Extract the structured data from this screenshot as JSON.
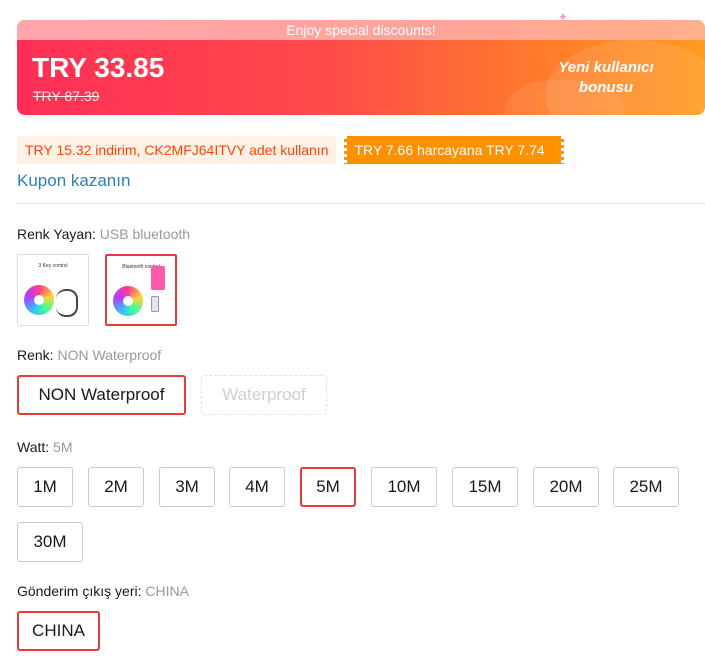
{
  "banner": {
    "strip_text": "Enjoy special discounts!",
    "price": "TRY 33.85",
    "original_price": "TRY 87.39",
    "bonus_label": "Yeni kullanıcı bonusu"
  },
  "coupons": {
    "discount_text": "TRY 15.32 indirim, CK2MFJ64ITVY adet kullanın",
    "threshold_text": "TRY 7.66 harcayana TRY 7.74"
  },
  "kupon_link": "Kupon kazanın",
  "renk_yayan": {
    "label": "Renk Yayan:",
    "value": "USB bluetooth",
    "thumbs": [
      {
        "caption": "3 Key control",
        "selected": false
      },
      {
        "caption": "Bluetooth control",
        "selected": true
      }
    ]
  },
  "renk": {
    "label": "Renk:",
    "value": "NON Waterproof",
    "options": [
      {
        "label": "NON Waterproof",
        "selected": true,
        "disabled": false
      },
      {
        "label": "Waterproof",
        "selected": false,
        "disabled": true
      }
    ]
  },
  "watt": {
    "label": "Watt:",
    "value": "5M",
    "options": [
      {
        "label": "1M",
        "selected": false
      },
      {
        "label": "2M",
        "selected": false
      },
      {
        "label": "3M",
        "selected": false
      },
      {
        "label": "4M",
        "selected": false
      },
      {
        "label": "5M",
        "selected": true
      },
      {
        "label": "10M",
        "selected": false
      },
      {
        "label": "15M",
        "selected": false
      },
      {
        "label": "20M",
        "selected": false
      },
      {
        "label": "25M",
        "selected": false
      },
      {
        "label": "30M",
        "selected": false
      }
    ]
  },
  "ship_from": {
    "label": "Gönderim çıkış yeri:",
    "value": "CHINA",
    "options": [
      {
        "label": "CHINA",
        "selected": true
      }
    ]
  },
  "colors": {
    "accent_red": "#e83a3a",
    "coupon_orange": "#ff9000",
    "link_blue": "#2e7fb8"
  }
}
